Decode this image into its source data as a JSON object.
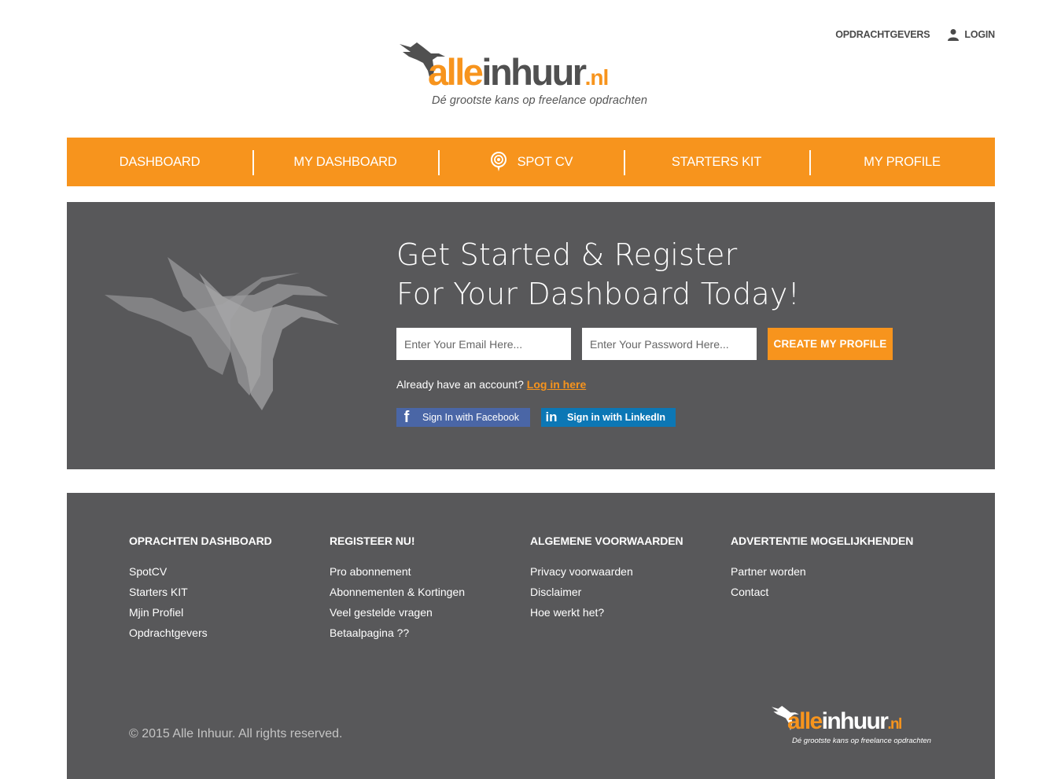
{
  "top_links": {
    "employers": "OPDRACHTGEVERS",
    "login": "LOGIN"
  },
  "logo": {
    "alle": "alle",
    "inhuur": "inhuur",
    "nl": ".nl",
    "tagline": "Dé grootste kans op freelance opdrachten"
  },
  "nav": {
    "items": [
      {
        "label": "DASHBOARD"
      },
      {
        "label": "MY DASHBOARD"
      },
      {
        "label": "SPOT CV"
      },
      {
        "label": "STARTERS KIT"
      },
      {
        "label": "MY PROFILE"
      }
    ]
  },
  "hero": {
    "title_line1": "Get Started & Register",
    "title_line2": "For Your Dashboard Today!",
    "email_placeholder": "Enter Your Email Here...",
    "password_placeholder": "Enter Your Password Here...",
    "create_button": "CREATE MY PROFILE",
    "already_text": "Already have an account?",
    "login_link": "Log in here",
    "facebook_button": "Sign In with Facebook",
    "linkedin_button": "Sign in with LinkedIn"
  },
  "footer": {
    "columns": [
      {
        "heading": "OPRACHTEN DASHBOARD",
        "links": [
          "SpotCV",
          "Starters KIT",
          "Mjin Profiel",
          "Opdrachtgevers"
        ]
      },
      {
        "heading": "REGISTEER NU!",
        "links": [
          "Pro abonnement",
          "Abonnementen & Kortingen",
          "Veel gestelde vragen",
          "Betaalpagina ??"
        ]
      },
      {
        "heading": "ALGEMENE VOORWAARDEN",
        "links": [
          "Privacy voorwaarden",
          "Disclaimer",
          "Hoe werkt het?"
        ]
      },
      {
        "heading": "ADVERTENTIE MOGELIJKHENDEN",
        "links": [
          "Partner worden",
          "Contact"
        ]
      }
    ],
    "copyright": "© 2015 Alle Inhuur. All rights reserved."
  },
  "colors": {
    "accent": "#f7941d",
    "dark_panel": "#58585a",
    "facebook": "#4a66a6",
    "linkedin": "#0c77b5"
  },
  "icons": {
    "user": "user-icon",
    "spot": "location-pin-icon",
    "bird": "hummingbird-icon",
    "facebook": "facebook-icon",
    "linkedin": "linkedin-icon"
  }
}
